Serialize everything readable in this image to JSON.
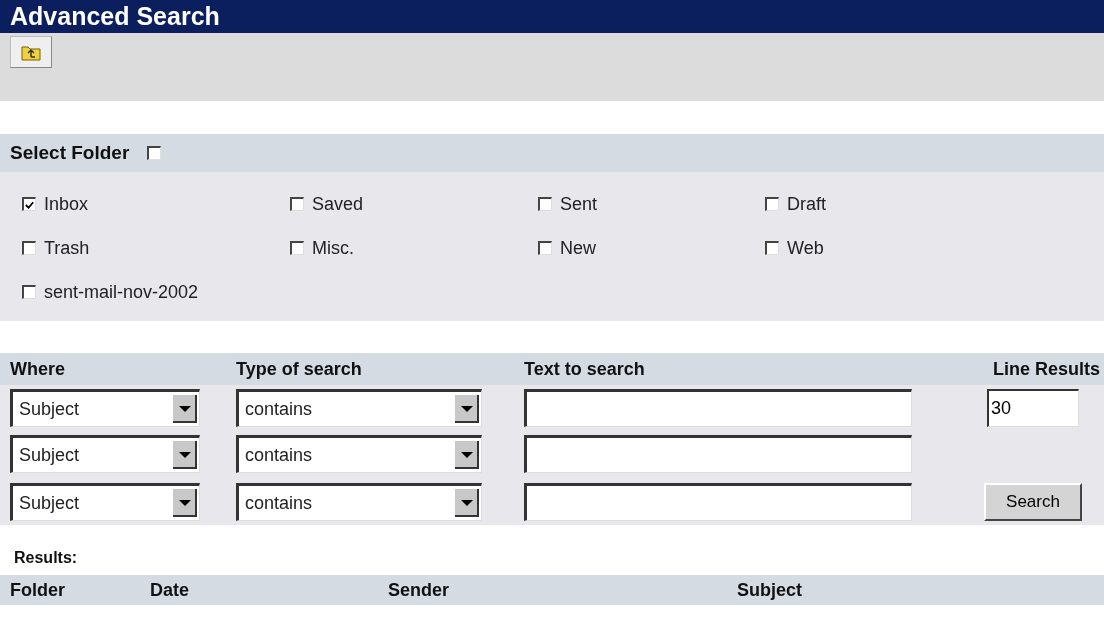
{
  "window": {
    "title": "Advanced Search"
  },
  "folder_select": {
    "label": "Select Folder",
    "checked": false
  },
  "folders": [
    {
      "label": "Inbox",
      "checked": true
    },
    {
      "label": "Saved",
      "checked": false
    },
    {
      "label": "Sent",
      "checked": false
    },
    {
      "label": "Draft",
      "checked": false
    },
    {
      "label": "Trash",
      "checked": false
    },
    {
      "label": "Misc.",
      "checked": false
    },
    {
      "label": "New",
      "checked": false
    },
    {
      "label": "Web",
      "checked": false
    },
    {
      "label": "sent-mail-nov-2002",
      "checked": false
    }
  ],
  "search": {
    "columns": [
      "Where",
      "Type of search",
      "Text to search",
      "Line Results"
    ],
    "rows": [
      {
        "where": "Subject",
        "type": "contains"
      },
      {
        "where": "Subject",
        "type": "contains"
      },
      {
        "where": "Subject",
        "type": "contains"
      }
    ],
    "line_results": "30",
    "button": "Search"
  },
  "results": {
    "label": "Results:",
    "columns": [
      "Folder",
      "Date",
      "Sender",
      "Subject"
    ]
  }
}
